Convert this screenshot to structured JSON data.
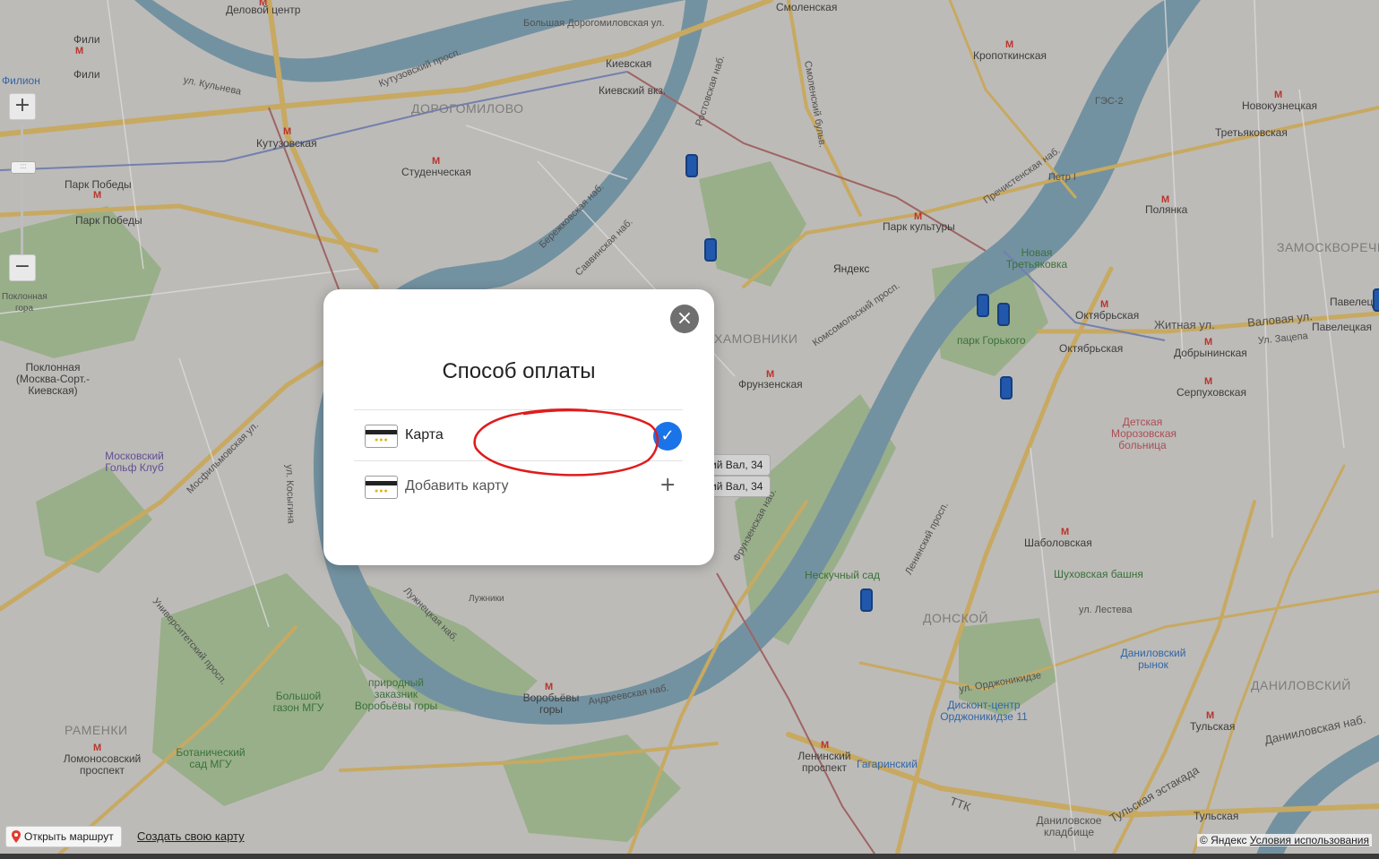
{
  "map": {
    "districts": [
      "ДОРОГОМИЛОВО",
      "ЗАМОСКВОРЕЧЬЕ",
      "ДОНСКОЙ",
      "ДАНИЛОВСКИЙ",
      "РАМЕНКИ",
      "ХАМОВНИКИ"
    ],
    "metro": [
      "Деловой центр",
      "Фили",
      "Фили",
      "Кутузовская",
      "Киевская",
      "Киевский вкз.",
      "Студенческая",
      "Парк Победы",
      "Парк Победы",
      "Смоленская",
      "Кропоткинская",
      "Парк культуры",
      "Фрунзенская",
      "Октябрьская",
      "Октябрьская",
      "Добрынинская",
      "Серпуховская",
      "Третьяковская",
      "Новокузнецкая",
      "Полянка",
      "Шаболовская",
      "Ленинский проспект",
      "Тульская",
      "Тульская",
      "Воробьёвы горы",
      "Ломоносовский проспект",
      "Павелецкая",
      "Павелецкая"
    ],
    "streets": [
      "Кутузовский просп.",
      "Большая Дорогомиловская ул.",
      "ул. Кульнева",
      "Бережковская наб.",
      "Саввинская наб.",
      "Ростовская наб.",
      "Смоленский бульв.",
      "Комсомольский просп.",
      "Фрунзенская наб.",
      "Пречистенская наб.",
      "ул. Косыгина",
      "Мосфильмовская ул.",
      "Университетский просп.",
      "Ленинский просп.",
      "Житная ул.",
      "Валовая ул.",
      "ул. Орджоникидзе",
      "Лужнецкая наб.",
      "Андреевская наб.",
      "ТТК",
      "Данииловская наб.",
      "Тульская эстакада",
      "ул. Лестева",
      "Ул. Зацепа"
    ],
    "pois": [
      "Филион",
      "Московский Гольф Клуб",
      "Поклонная (Москва-Сорт.-Киевская)",
      "Большой газон МГУ",
      "природный заказник Воробьёвы горы",
      "Ботанический сад МГУ",
      "Лужники",
      "Нескучный сад",
      "парк Горького",
      "Новая Третьяковка",
      "Яндекс",
      "Детская Морозовская больница",
      "Шуховская башня",
      "Даниловский рынок",
      "Дисконт-центр Орджоникидзе 11",
      "Гагаринский",
      "Даниловское кладбище",
      "Петр I",
      "ГЭС-2",
      "Поклонная гора"
    ],
    "address_tags": [
      "ий Вал, 34",
      "ий Вал, 34"
    ],
    "colors": {
      "water": "#7fa5b8",
      "park": "#9cc28c",
      "road": "#e6c16a",
      "land": "#d9d7d3",
      "metro": "#d6322a"
    }
  },
  "zoom": {
    "plus": "+",
    "minus": "−",
    "handle": ":::"
  },
  "footer": {
    "route_button": "Открыть маршрут",
    "create_map_link": "Создать свою карту",
    "copyright": "© Яндекс",
    "terms_link": "Условия использования"
  },
  "modal": {
    "title": "Способ оплаты",
    "close_icon": "×",
    "options": [
      {
        "label": "Карта",
        "selected": true,
        "icon": "card-icon"
      },
      {
        "label": "Добавить карту",
        "selected": false,
        "icon": "card-icon"
      }
    ],
    "check_icon": "✓",
    "plus_icon": "+",
    "annotation_color": "#e01b1b"
  }
}
